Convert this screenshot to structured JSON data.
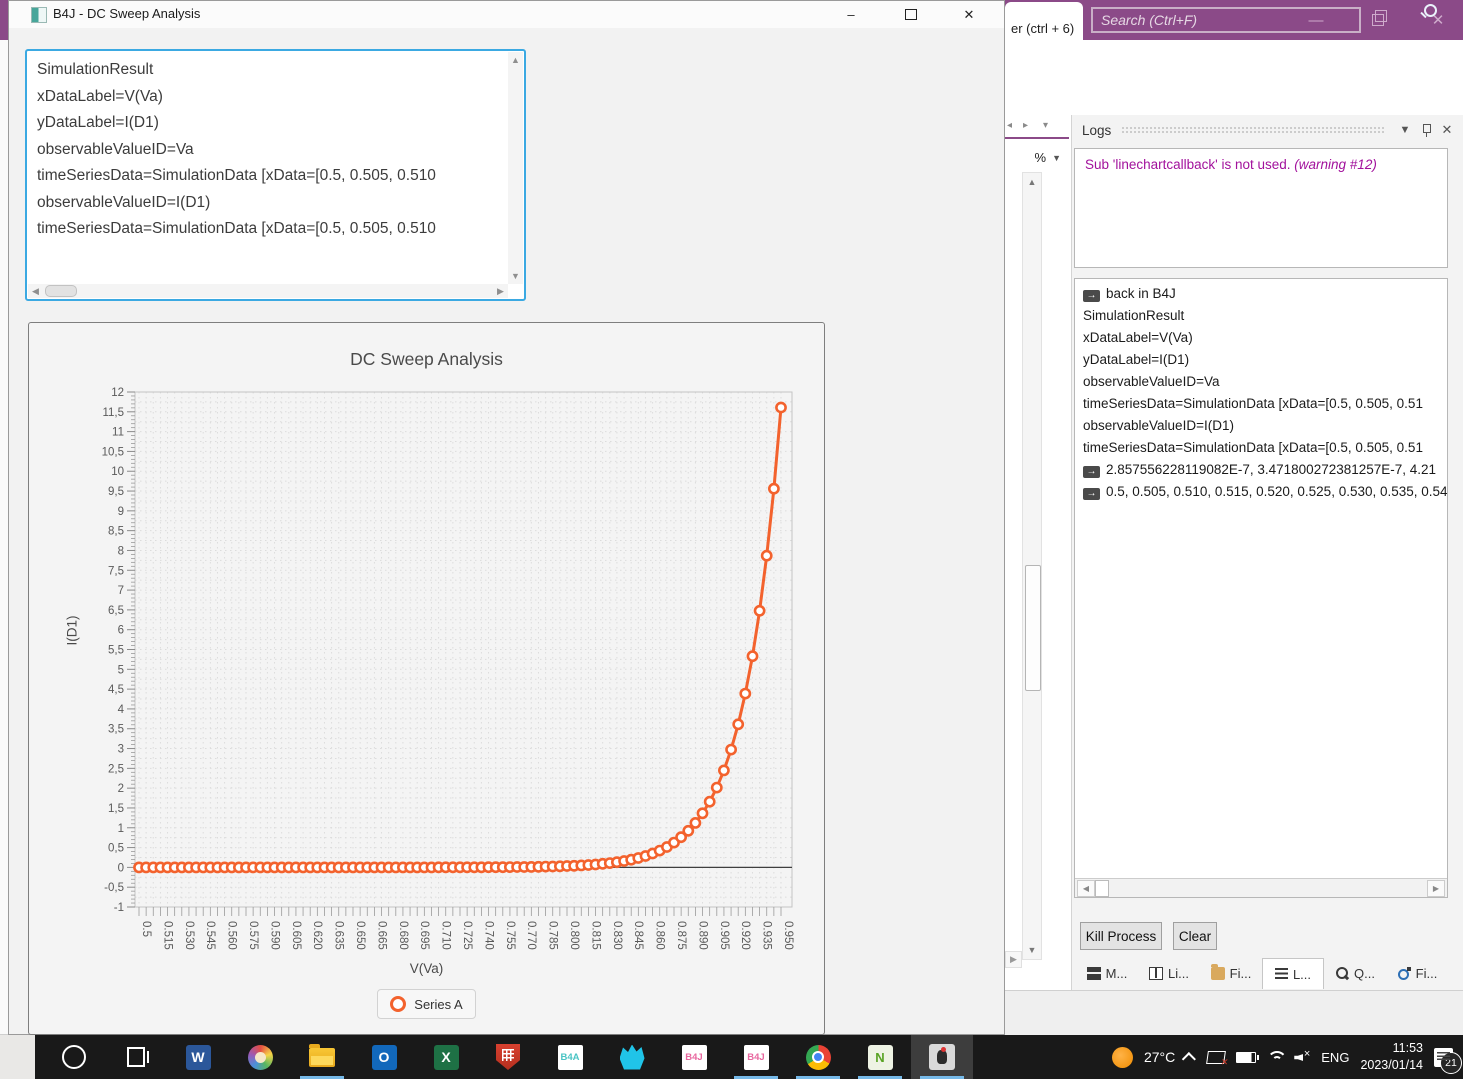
{
  "front_window": {
    "title": "B4J - DC Sweep Analysis",
    "controls": {
      "minimize": "–",
      "close": "✕"
    },
    "textarea_lines": [
      "SimulationResult",
      "xDataLabel=V(Va)",
      "yDataLabel=I(D1)",
      "observableValueID=Va",
      "timeSeriesData=SimulationData [xData=[0.5, 0.505, 0.510",
      "observableValueID=I(D1)",
      "timeSeriesData=SimulationData [xData=[0.5, 0.505, 0.510"
    ]
  },
  "chart_data": {
    "type": "line",
    "title": "DC Sweep Analysis",
    "xlabel": "V(Va)",
    "ylabel": "I(D1)",
    "legend_position": "bottom",
    "grid": "dashed",
    "ylim": [
      -1,
      12
    ],
    "y_tick_step": 0.5,
    "decimal_separator_y": ",",
    "y_tick_labels": [
      "12",
      "11,5",
      "11",
      "10,5",
      "10",
      "9,5",
      "9",
      "8,5",
      "8",
      "7,5",
      "7",
      "6,5",
      "6",
      "5,5",
      "5",
      "4,5",
      "4",
      "3,5",
      "3",
      "2,5",
      "2",
      "1,5",
      "1",
      "0,5",
      "0",
      "-0,5",
      "-1"
    ],
    "x_tick_every": 3,
    "x_tick_labels": [
      "0.5",
      "0.515",
      "0.530",
      "0.545",
      "0.560",
      "0.575",
      "0.590",
      "0.605",
      "0.620",
      "0.635",
      "0.650",
      "0.665",
      "0.680",
      "0.695",
      "0.710",
      "0.725",
      "0.740",
      "0.755",
      "0.770",
      "0.785",
      "0.800",
      "0.815",
      "0.830",
      "0.845",
      "0.860",
      "0.875",
      "0.890",
      "0.905",
      "0.920",
      "0.935",
      "0.950"
    ],
    "series": [
      {
        "name": "Series A",
        "color": "#f3622d",
        "x": [
          0.5,
          0.505,
          0.51,
          0.515,
          0.52,
          0.525,
          0.53,
          0.535,
          0.54,
          0.545,
          0.55,
          0.555,
          0.56,
          0.565,
          0.57,
          0.575,
          0.58,
          0.585,
          0.59,
          0.595,
          0.6,
          0.605,
          0.61,
          0.615,
          0.62,
          0.625,
          0.63,
          0.635,
          0.64,
          0.645,
          0.65,
          0.655,
          0.66,
          0.665,
          0.67,
          0.675,
          0.68,
          0.685,
          0.69,
          0.695,
          0.7,
          0.705,
          0.71,
          0.715,
          0.72,
          0.725,
          0.73,
          0.735,
          0.74,
          0.745,
          0.75,
          0.755,
          0.76,
          0.765,
          0.77,
          0.775,
          0.78,
          0.785,
          0.79,
          0.795,
          0.8,
          0.805,
          0.81,
          0.815,
          0.82,
          0.825,
          0.83,
          0.835,
          0.84,
          0.845,
          0.85,
          0.855,
          0.86,
          0.865,
          0.87,
          0.875,
          0.88,
          0.885,
          0.89,
          0.895,
          0.9,
          0.905,
          0.91,
          0.915,
          0.92,
          0.925,
          0.93,
          0.935,
          0.94,
          0.945,
          0.95
        ],
        "y": [
          2.858e-07,
          3.472e-07,
          4.218e-07,
          5.124e-07,
          6.226e-07,
          7.564e-07,
          9.189e-07,
          1.116e-06,
          1.356e-06,
          1.648e-06,
          2.002e-06,
          2.432e-06,
          2.954e-06,
          3.589e-06,
          4.361e-06,
          5.298e-06,
          6.436e-06,
          7.819e-06,
          9.5e-06,
          1.154e-05,
          1.402e-05,
          1.704e-05,
          2.07e-05,
          2.514e-05,
          3.055e-05,
          3.712e-05,
          4.509e-05,
          5.478e-05,
          6.656e-05,
          8.086e-05,
          9.824e-05,
          0.0001193,
          0.000145,
          0.0001762,
          0.0002141,
          0.0002601,
          0.0003159,
          0.0003839,
          0.0004664,
          0.0005666,
          0.0006883,
          0.0008363,
          0.001016,
          0.001234,
          0.0015,
          0.001822,
          0.002213,
          0.002689,
          0.003267,
          0.003969,
          0.004822,
          0.005859,
          0.007118,
          0.008647,
          0.0105,
          0.01276,
          0.01551,
          0.01884,
          0.02289,
          0.0278,
          0.03378,
          0.04104,
          0.04986,
          0.06057,
          0.07359,
          0.08941,
          0.1086,
          0.132,
          0.1603,
          0.1948,
          0.2366,
          0.2875,
          0.3493,
          0.4243,
          0.5155,
          0.6263,
          0.7609,
          0.9244,
          1.123,
          1.365,
          1.658,
          2.014,
          2.447,
          2.973,
          3.611,
          4.388,
          5.331,
          6.476,
          7.868,
          9.559,
          11.61
        ]
      }
    ]
  },
  "ide": {
    "editor_tab": "er  (ctrl + 6)",
    "search_placeholder": "Search (Ctrl+F)",
    "zoom_combo": "%",
    "logs_panel": {
      "title": "Logs",
      "warning_text": "Sub 'linechartcallback' is not used. ",
      "warning_suffix": "(warning #12)",
      "entries": [
        {
          "arrow": true,
          "text": "back in B4J"
        },
        {
          "arrow": false,
          "text": "SimulationResult"
        },
        {
          "arrow": false,
          "text": "xDataLabel=V(Va)"
        },
        {
          "arrow": false,
          "text": "yDataLabel=I(D1)"
        },
        {
          "arrow": false,
          "text": "observableValueID=Va"
        },
        {
          "arrow": false,
          "text": "timeSeriesData=SimulationData [xData=[0.5, 0.505, 0.51"
        },
        {
          "arrow": false,
          "text": "observableValueID=I(D1)"
        },
        {
          "arrow": false,
          "text": "timeSeriesData=SimulationData [xData=[0.5, 0.505, 0.51"
        },
        {
          "arrow": true,
          "text": "2.857556228119082E-7, 3.471800272381257E-7, 4.21"
        },
        {
          "arrow": true,
          "text": "0.5, 0.505, 0.510, 0.515, 0.520, 0.525, 0.530, 0.535, 0.54"
        }
      ],
      "kill_button": "Kill Process",
      "clear_button": "Clear",
      "tabs": [
        {
          "icon": "modules",
          "label": "M...",
          "selected": false
        },
        {
          "icon": "book",
          "label": "Li...",
          "selected": false
        },
        {
          "icon": "folder",
          "label": "Fi...",
          "selected": false
        },
        {
          "icon": "loglines",
          "label": "L...",
          "selected": true
        },
        {
          "icon": "search2",
          "label": "Q...",
          "selected": false
        },
        {
          "icon": "find",
          "label": "Fi...",
          "selected": false
        }
      ]
    }
  },
  "taskbar": {
    "apps": [
      {
        "icon": "cortana",
        "running": false,
        "active": false
      },
      {
        "icon": "taskview",
        "running": false,
        "active": false
      },
      {
        "icon": "word",
        "text": "W",
        "running": false,
        "active": false
      },
      {
        "icon": "paint",
        "running": false,
        "active": false
      },
      {
        "icon": "explorer",
        "running": true,
        "active": false
      },
      {
        "icon": "outlook",
        "text": "O",
        "running": false,
        "active": false
      },
      {
        "icon": "excel",
        "text": "X",
        "running": false,
        "active": false
      },
      {
        "icon": "shield",
        "running": false,
        "active": false
      },
      {
        "icon": "b4a",
        "text": "B4A",
        "running": false,
        "active": false
      },
      {
        "icon": "b4i",
        "running": false,
        "active": false
      },
      {
        "icon": "b4j",
        "text": "B4J",
        "running": false,
        "active": false
      },
      {
        "icon": "b4j",
        "text": "B4J",
        "running": true,
        "active": false
      },
      {
        "icon": "chrome",
        "running": true,
        "active": false
      },
      {
        "icon": "npp",
        "text": "N",
        "running": true,
        "active": false
      },
      {
        "icon": "java",
        "running": true,
        "active": true
      }
    ],
    "tray": {
      "temp": "27°C",
      "lang": "ENG",
      "time": "11:53",
      "date": "2023/01/14",
      "badge": "21"
    }
  }
}
